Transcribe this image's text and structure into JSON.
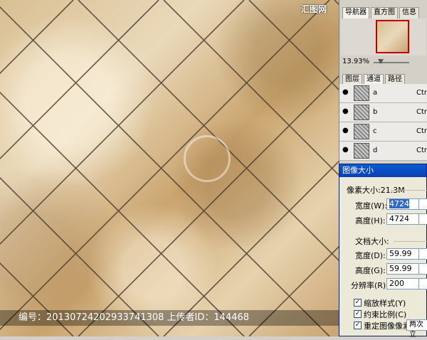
{
  "watermark": {
    "site": "汇图网",
    "caption": "编号：20130724202933741308 上传者ID：144468"
  },
  "navigator": {
    "tabs": [
      "导航器",
      "直方图",
      "信息"
    ],
    "zoom": "13.93%"
  },
  "layers_panel": {
    "tabs": [
      "图层",
      "通道",
      "路径"
    ],
    "channels": [
      {
        "name": "a",
        "shortcut": "Ctrl"
      },
      {
        "name": "b",
        "shortcut": "Ctrl"
      },
      {
        "name": "c",
        "shortcut": "Ctrl"
      },
      {
        "name": "d",
        "shortcut": "Ctrl"
      }
    ]
  },
  "image_size_dialog": {
    "title": "图像大小",
    "pixel_dimensions_label": "像素大小:21.3M",
    "width_label": "宽度(W):",
    "width_value": "4724",
    "height_label": "高度(H):",
    "height_value": "4724",
    "document_size_label": "文档大小:",
    "doc_width_label": "宽度(D):",
    "doc_width_value": "59.99",
    "doc_height_label": "高度(G):",
    "doc_height_value": "59.99",
    "resolution_label": "分辨率(R):",
    "resolution_value": "200",
    "scale_styles_label": "缩放样式(Y)",
    "constrain_label": "约束比例(C)",
    "resample_label": "重定图像像素(I):",
    "resample_value": "两次立"
  }
}
